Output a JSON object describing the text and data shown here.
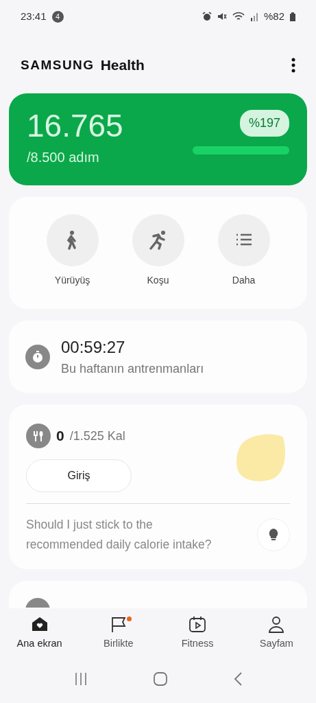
{
  "status_bar": {
    "time": "23:41",
    "notification_count": "4",
    "battery": "%82"
  },
  "app_bar": {
    "brand": "SAMSUNG",
    "title": "Health"
  },
  "steps": {
    "count": "16.765",
    "goal": "/8.500 adım",
    "percent": "%197",
    "level": 1
  },
  "activities": [
    {
      "kind": "walk",
      "label": "Yürüyüş"
    },
    {
      "kind": "run",
      "label": "Koşu"
    },
    {
      "kind": "more",
      "label": "Daha"
    }
  ],
  "workouts": {
    "time": "00:59:27",
    "caption": "Bu haftanın antrenmanları"
  },
  "food": {
    "value": "0",
    "goal": "/1.525 Kal",
    "button": "Giriş",
    "question": "Should I just stick to the recommended daily calorie intake?"
  },
  "bottom_nav": [
    {
      "kind": "home",
      "label": "Ana ekran",
      "selected": true,
      "has_dot": false
    },
    {
      "kind": "together",
      "label": "Birlikte",
      "selected": false,
      "has_dot": true
    },
    {
      "kind": "fitness",
      "label": "Fitness",
      "selected": false,
      "has_dot": false
    },
    {
      "kind": "profile",
      "label": "Sayfam",
      "selected": false,
      "has_dot": false
    }
  ]
}
